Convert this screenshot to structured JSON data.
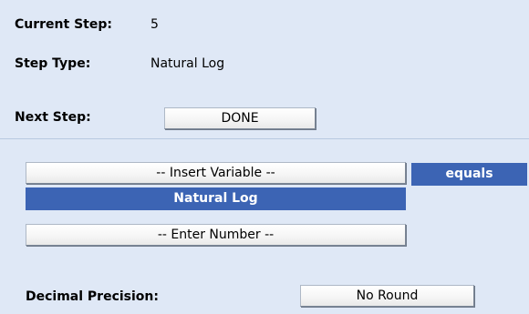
{
  "step_info": {
    "current_step_label": "Current Step:",
    "current_step_value": "5",
    "step_type_label": "Step Type:",
    "step_type_value": "Natural Log",
    "next_step_label": "Next Step:",
    "next_step_button": "DONE"
  },
  "formula": {
    "insert_variable_button": "-- Insert Variable --",
    "equals_label": "equals",
    "operation_label": "Natural Log",
    "enter_number_button": "-- Enter Number --"
  },
  "precision": {
    "label": "Decimal Precision:",
    "value_button": "No Round"
  },
  "colors": {
    "background": "#dfe8f6",
    "highlight": "#3c64b4"
  }
}
